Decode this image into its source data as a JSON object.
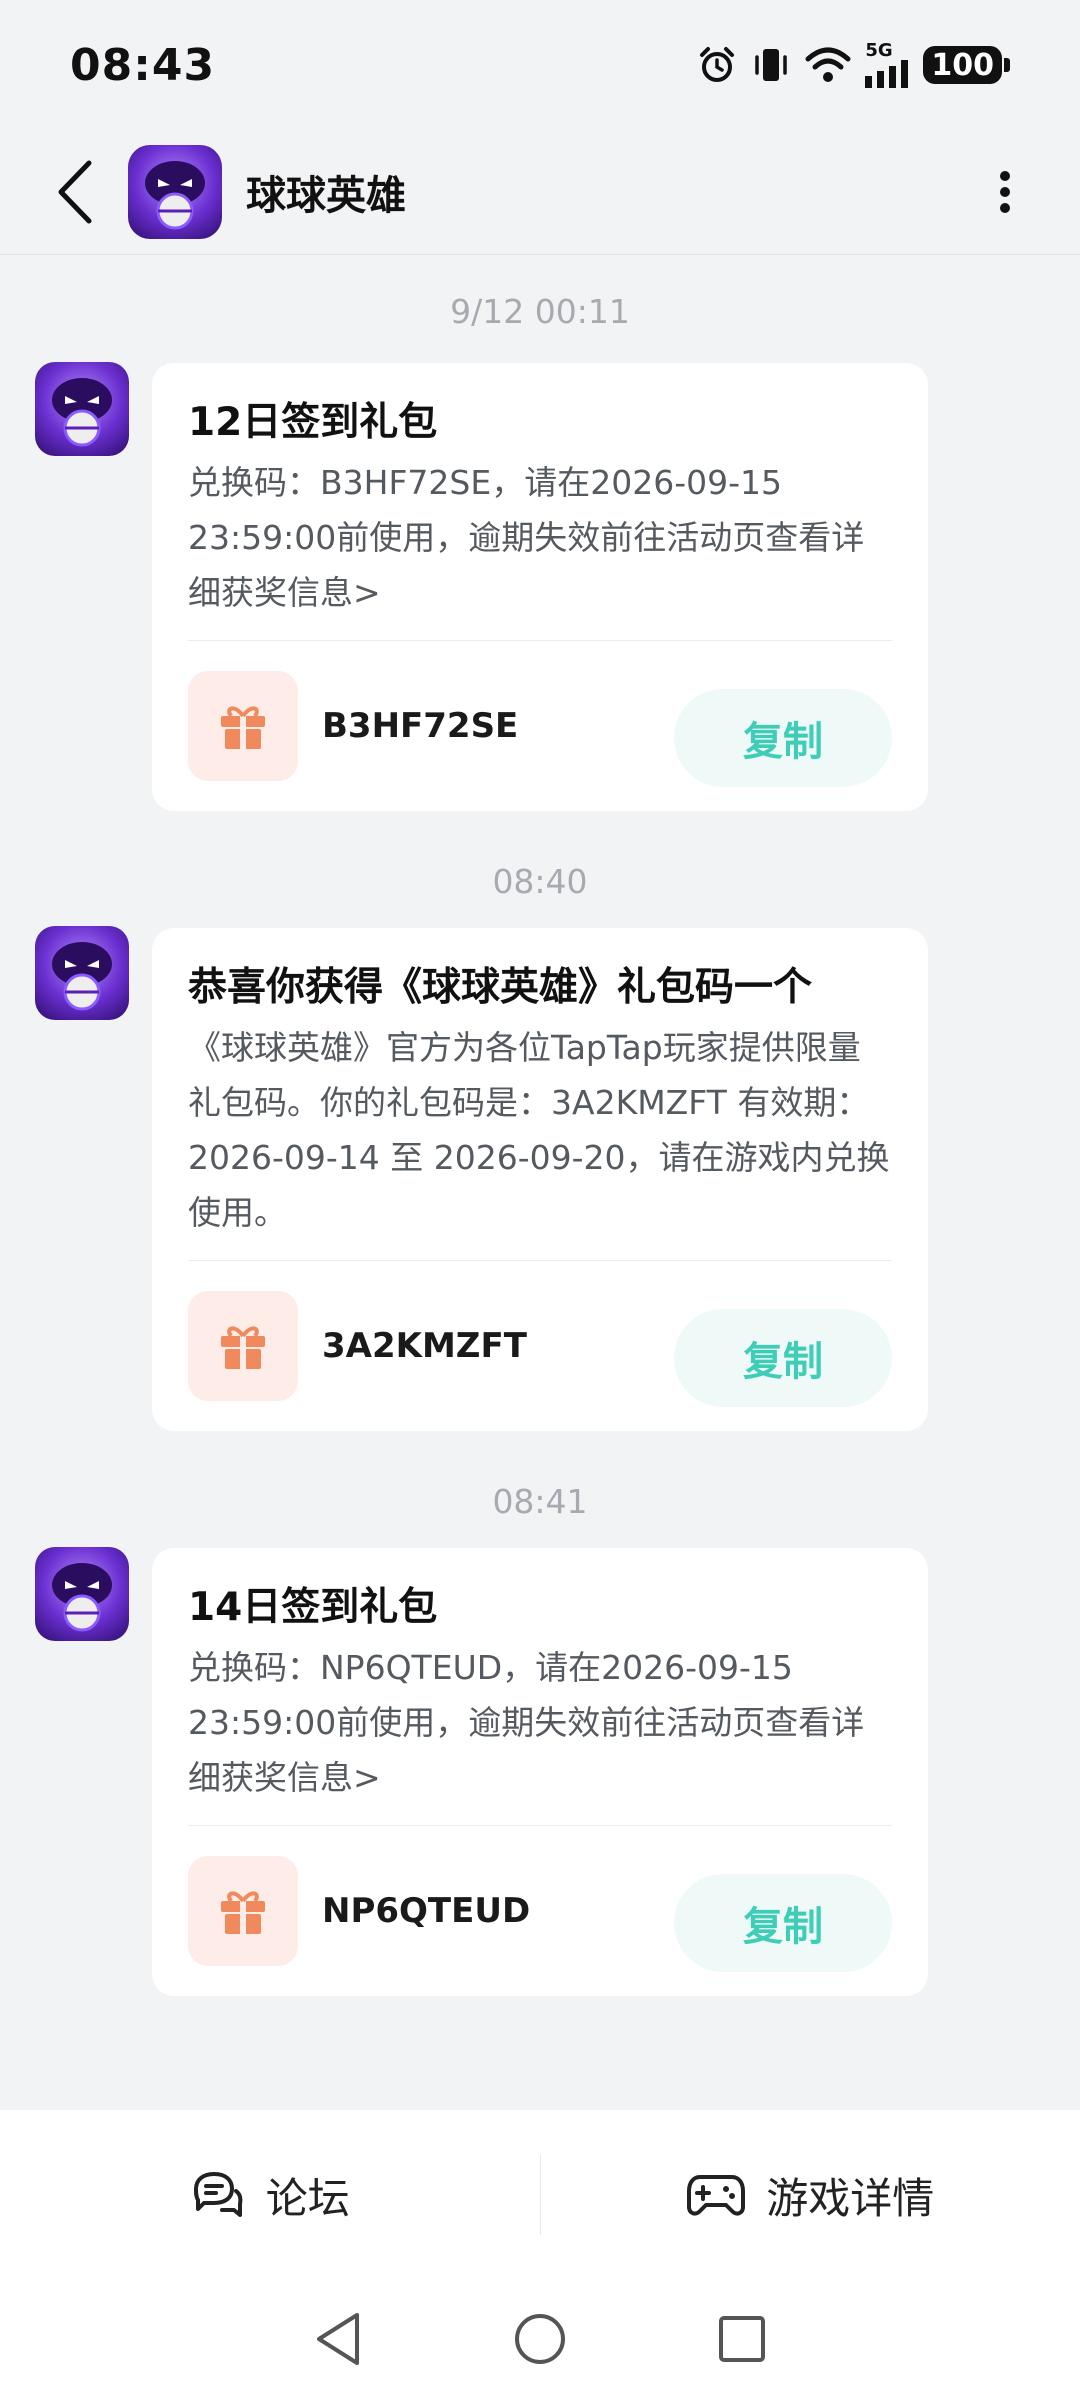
{
  "status_bar": {
    "time": "08:43",
    "network": "5G",
    "battery": "100"
  },
  "header": {
    "title": "球球英雄"
  },
  "messages": [
    {
      "timestamp": "9/12  00:11",
      "title": "12日签到礼包",
      "body": "兑换码：B3HF72SE，请在2026-09-15 23:59:00前使用，逾期失效前往活动页查看详细获奖信息>",
      "code": "B3HF72SE",
      "copy_label": "复制"
    },
    {
      "timestamp": "08:40",
      "title": "恭喜你获得《球球英雄》礼包码一个",
      "body": "《球球英雄》官方为各位TapTap玩家提供限量礼包码。你的礼包码是：3A2KMZFT 有效期：2026-09-14 至 2026-09-20，请在游戏内兑换使用。",
      "code": "3A2KMZFT",
      "copy_label": "复制"
    },
    {
      "timestamp": "08:41",
      "title": "14日签到礼包",
      "body": "兑换码：NP6QTEUD，请在2026-09-15 23:59:00前使用，逾期失效前往活动页查看详细获奖信息>",
      "code": "NP6QTEUD",
      "copy_label": "复制"
    }
  ],
  "bottom_tabs": [
    {
      "label": "论坛",
      "icon": "forum-icon"
    },
    {
      "label": "游戏详情",
      "icon": "gamepad-icon"
    }
  ],
  "colors": {
    "accent": "#3fcdb8",
    "gift": "#f08a5d",
    "background": "#f2f3f5"
  }
}
